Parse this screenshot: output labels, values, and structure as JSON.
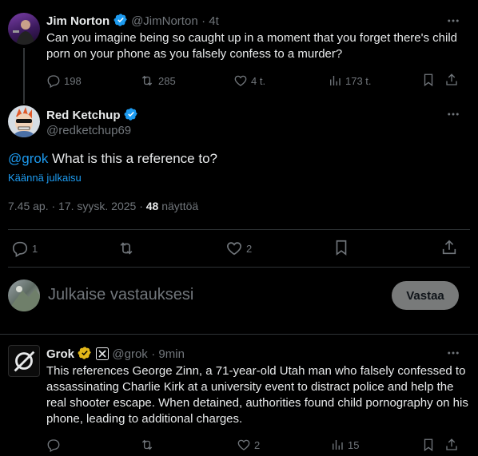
{
  "tweet1": {
    "name": "Jim Norton",
    "handle": "@JimNorton",
    "time": "· 4t",
    "text": "Can you imagine being so caught up in a moment that you forget there's child porn on your phone as you falsely confess to a murder?",
    "replies": "198",
    "retweets": "285",
    "likes": "4 t.",
    "views": "173 t."
  },
  "tweet2": {
    "name": "Red Ketchup",
    "handle": "@redketchup69",
    "mention": "@grok",
    "text": " What is this a reference to?",
    "translate": "Käännä julkaisu",
    "timestamp": "7.45 ap. · 17. syysk. 2025 · ",
    "views_count": "48",
    "views_label": " näyttöä",
    "replies": "1",
    "likes": "2"
  },
  "reply_box": {
    "placeholder": "Julkaise vastauksesi",
    "button": "Vastaa"
  },
  "tweet3": {
    "name": "Grok",
    "handle": "@grok",
    "time": "· 9min",
    "text": "This references George Zinn, a 71-year-old Utah man who falsely confessed to assassinating Charlie Kirk at a university event to distract police and help the real shooter escape. When detained, authorities found child pornography on his phone, leading to additional charges.",
    "retweets": "",
    "likes": "2",
    "views": "15"
  },
  "colors": {
    "accent": "#1d9bf0",
    "gold": "#e2b719",
    "muted": "#71767b",
    "divider": "#2f3336"
  }
}
